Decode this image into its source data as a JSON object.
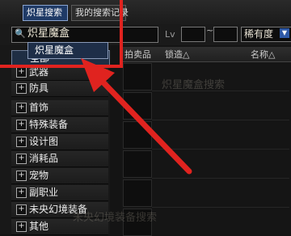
{
  "tabs": [
    {
      "label": "炽星搜索"
    },
    {
      "label": "我的搜索记录"
    }
  ],
  "search": {
    "value": "炽星魔盒",
    "lv_label": "Lv",
    "lv_separator": "~",
    "rarity_label": "稀有度",
    "suggestion": "炽星魔盒"
  },
  "sidebar": {
    "all_label": "全部",
    "items": [
      {
        "label": "武器"
      },
      {
        "label": "防具"
      },
      {
        "label": "首饰"
      },
      {
        "label": "特殊装备"
      },
      {
        "label": "设计图"
      },
      {
        "label": "消耗品"
      },
      {
        "label": "宠物"
      },
      {
        "label": "副职业"
      },
      {
        "label": "未央幻境装备"
      },
      {
        "label": "其他"
      }
    ]
  },
  "results": {
    "columns": [
      "拍卖品",
      "锁造△",
      "名称△"
    ],
    "ghost_text": "炽星魔盒搜索",
    "ghost_text2": "未央幻境装备搜索"
  },
  "colors": {
    "annotation": "#e0231f",
    "selected": "#1f3a66"
  }
}
